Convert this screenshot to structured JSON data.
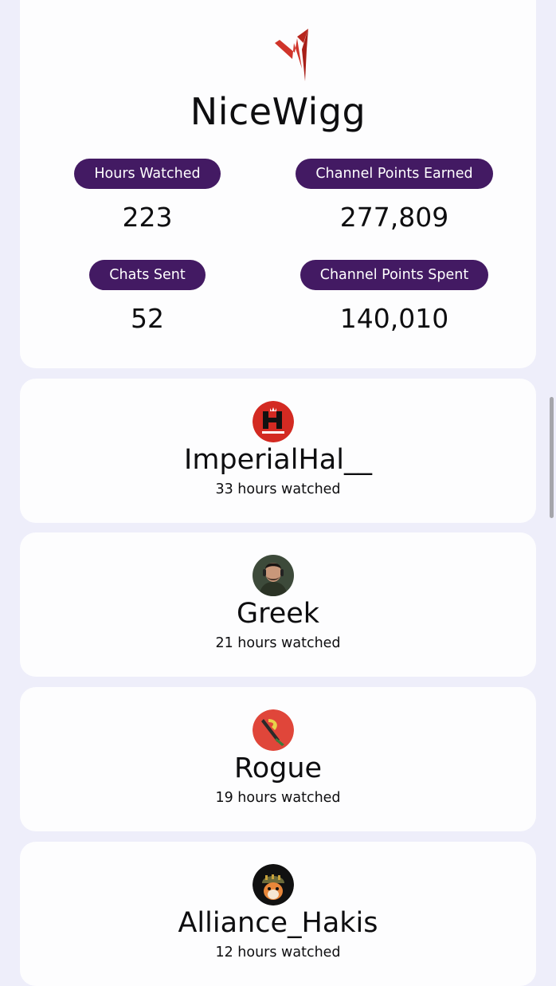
{
  "channel": {
    "name": "NiceWigg",
    "logo_icon": "red-lightning-logo-icon"
  },
  "stats": {
    "hours_watched": {
      "label": "Hours Watched",
      "value": "223"
    },
    "channel_points_earned": {
      "label": "Channel Points Earned",
      "value": "277,809"
    },
    "chats_sent": {
      "label": "Chats Sent",
      "value": "52"
    },
    "channel_points_spent": {
      "label": "Channel Points Spent",
      "value": "140,010"
    }
  },
  "top_streamers": [
    {
      "name": "ImperialHal__",
      "hours": "33 hours watched",
      "avatar_icon": "imperialhal-logo-icon"
    },
    {
      "name": "Greek",
      "hours": "21 hours watched",
      "avatar_icon": "person-avatar-icon"
    },
    {
      "name": "Rogue",
      "hours": "19 hours watched",
      "avatar_icon": "sword-logo-icon"
    },
    {
      "name": "Alliance_Hakis",
      "hours": "12 hours watched",
      "avatar_icon": "dog-soldier-avatar-icon"
    }
  ],
  "colors": {
    "page_background": "#eeeefa",
    "card_background": "#fdfdfe",
    "pill_background": "#431a63",
    "pill_text": "#ffffff",
    "logo_red": "#c8281e",
    "top_tab": "#f3f0b9"
  }
}
